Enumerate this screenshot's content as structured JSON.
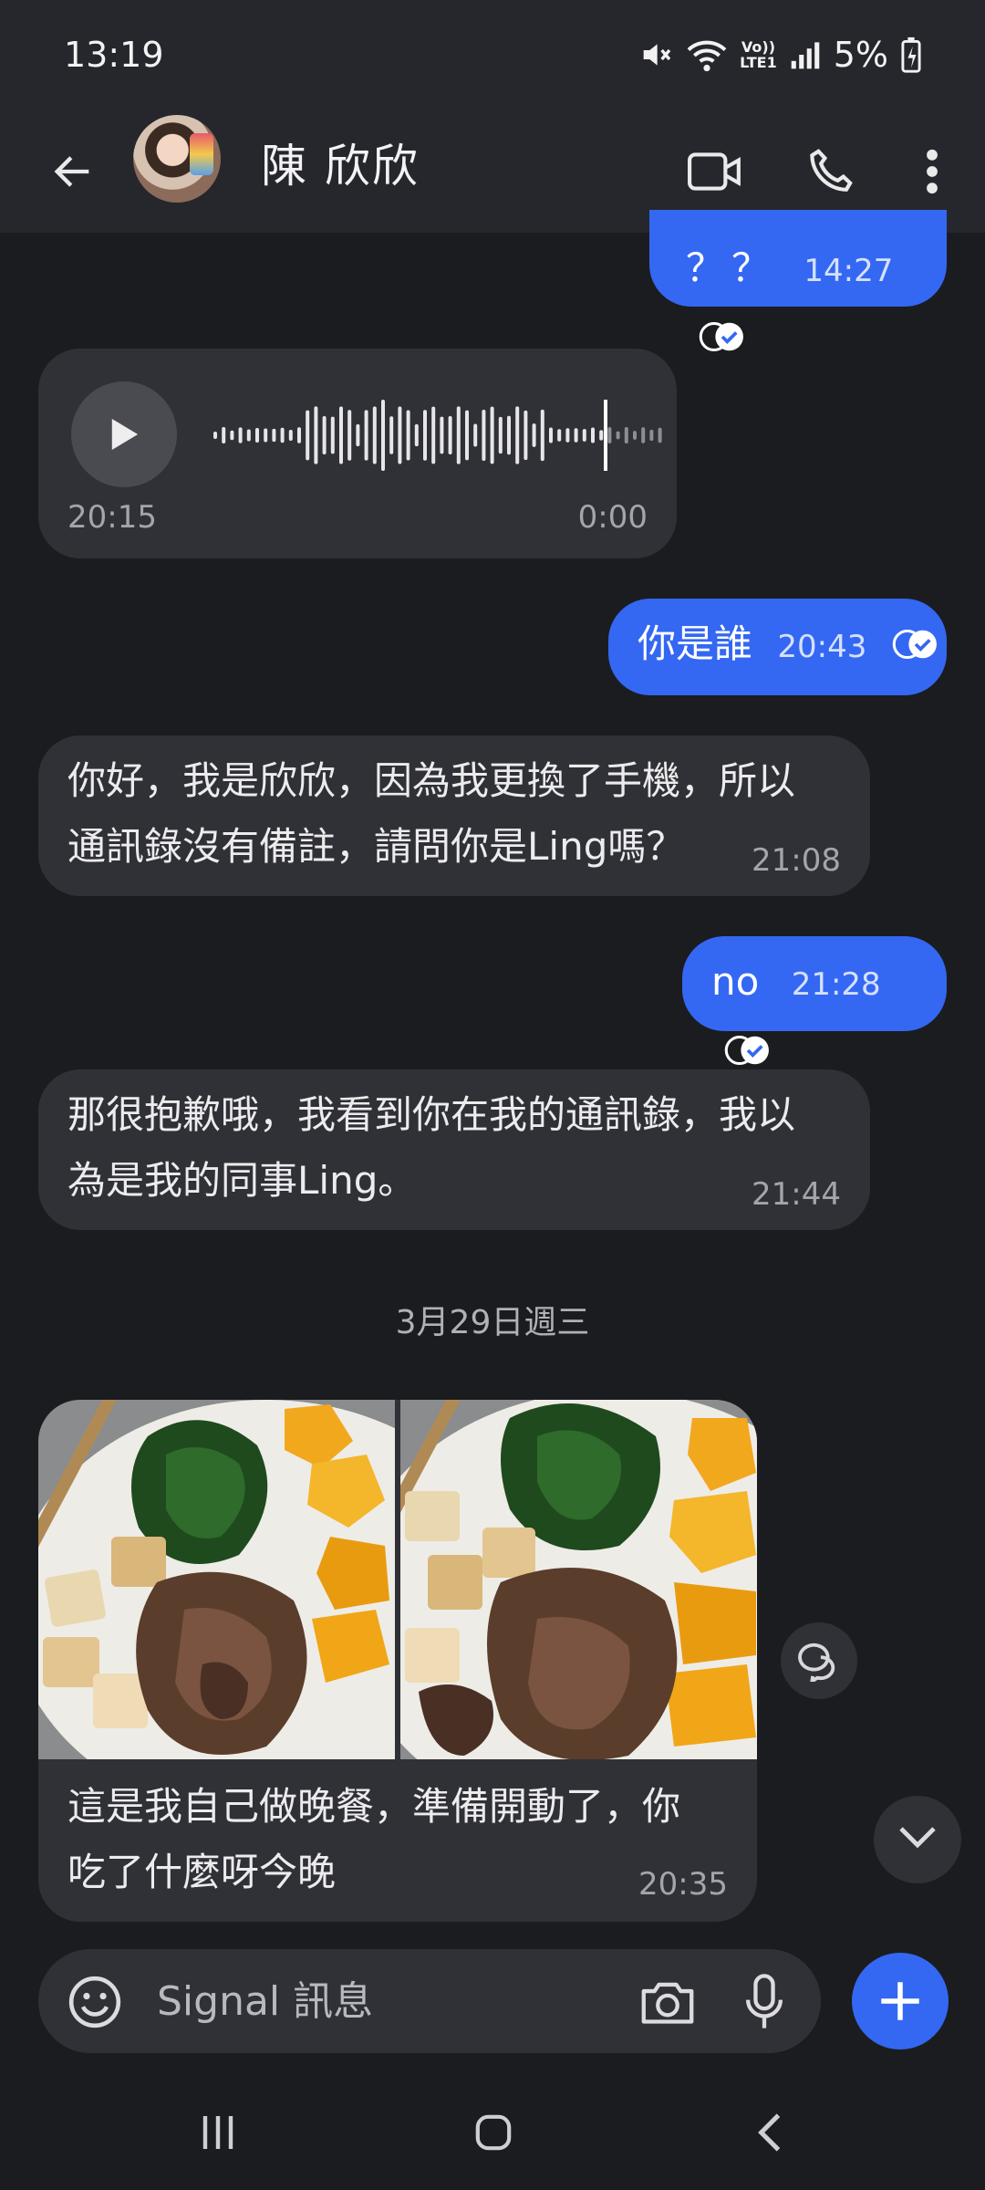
{
  "status_bar": {
    "time": "13:19",
    "battery": "5%",
    "icons": [
      "mute-icon",
      "wifi-icon",
      "volte-icon",
      "signal-icon",
      "battery-charging-icon"
    ],
    "volte_label": "VoLTE1"
  },
  "header": {
    "contact_name": "陳 欣欣",
    "icons": [
      "back-arrow-icon",
      "video-call-icon",
      "phone-icon",
      "more-icon"
    ]
  },
  "colors": {
    "outgoing_bubble": "#3468f2",
    "incoming_bubble": "#303136",
    "background": "#1b1c1f",
    "header": "#25272c"
  },
  "messages": [
    {
      "direction": "out",
      "text": "？？",
      "time": "14:27",
      "status": "read"
    },
    {
      "direction": "in",
      "type": "voice",
      "time": "20:15",
      "duration": "0:00"
    },
    {
      "direction": "out",
      "text": "你是誰",
      "time": "20:43",
      "status": "read"
    },
    {
      "direction": "in",
      "text_line1": "你好，我是欣欣，因為我更換了手機，所以",
      "text_line2": "通訊錄沒有備註，請問你是Ling嗎？",
      "time": "21:08"
    },
    {
      "direction": "out",
      "text": "no",
      "time": "21:28",
      "status": "read"
    },
    {
      "direction": "in",
      "text_line1": "那很抱歉哦，我看到你在我的通訊錄，我以",
      "text_line2": "為是我的同事Ling。",
      "time": "21:44"
    },
    {
      "direction": "in",
      "type": "photos",
      "text_line1": "這是我自己做晚餐，準備開動了，你",
      "text_line2": "吃了什麼呀今晚",
      "time": "20:35"
    }
  ],
  "date_separator": "3月29日週三",
  "composer": {
    "placeholder": "Signal 訊息",
    "icons": [
      "emoji-icon",
      "camera-icon",
      "microphone-icon",
      "plus-icon"
    ]
  },
  "nav_bar": {
    "icons": [
      "recent-apps-icon",
      "home-icon",
      "back-icon"
    ]
  }
}
